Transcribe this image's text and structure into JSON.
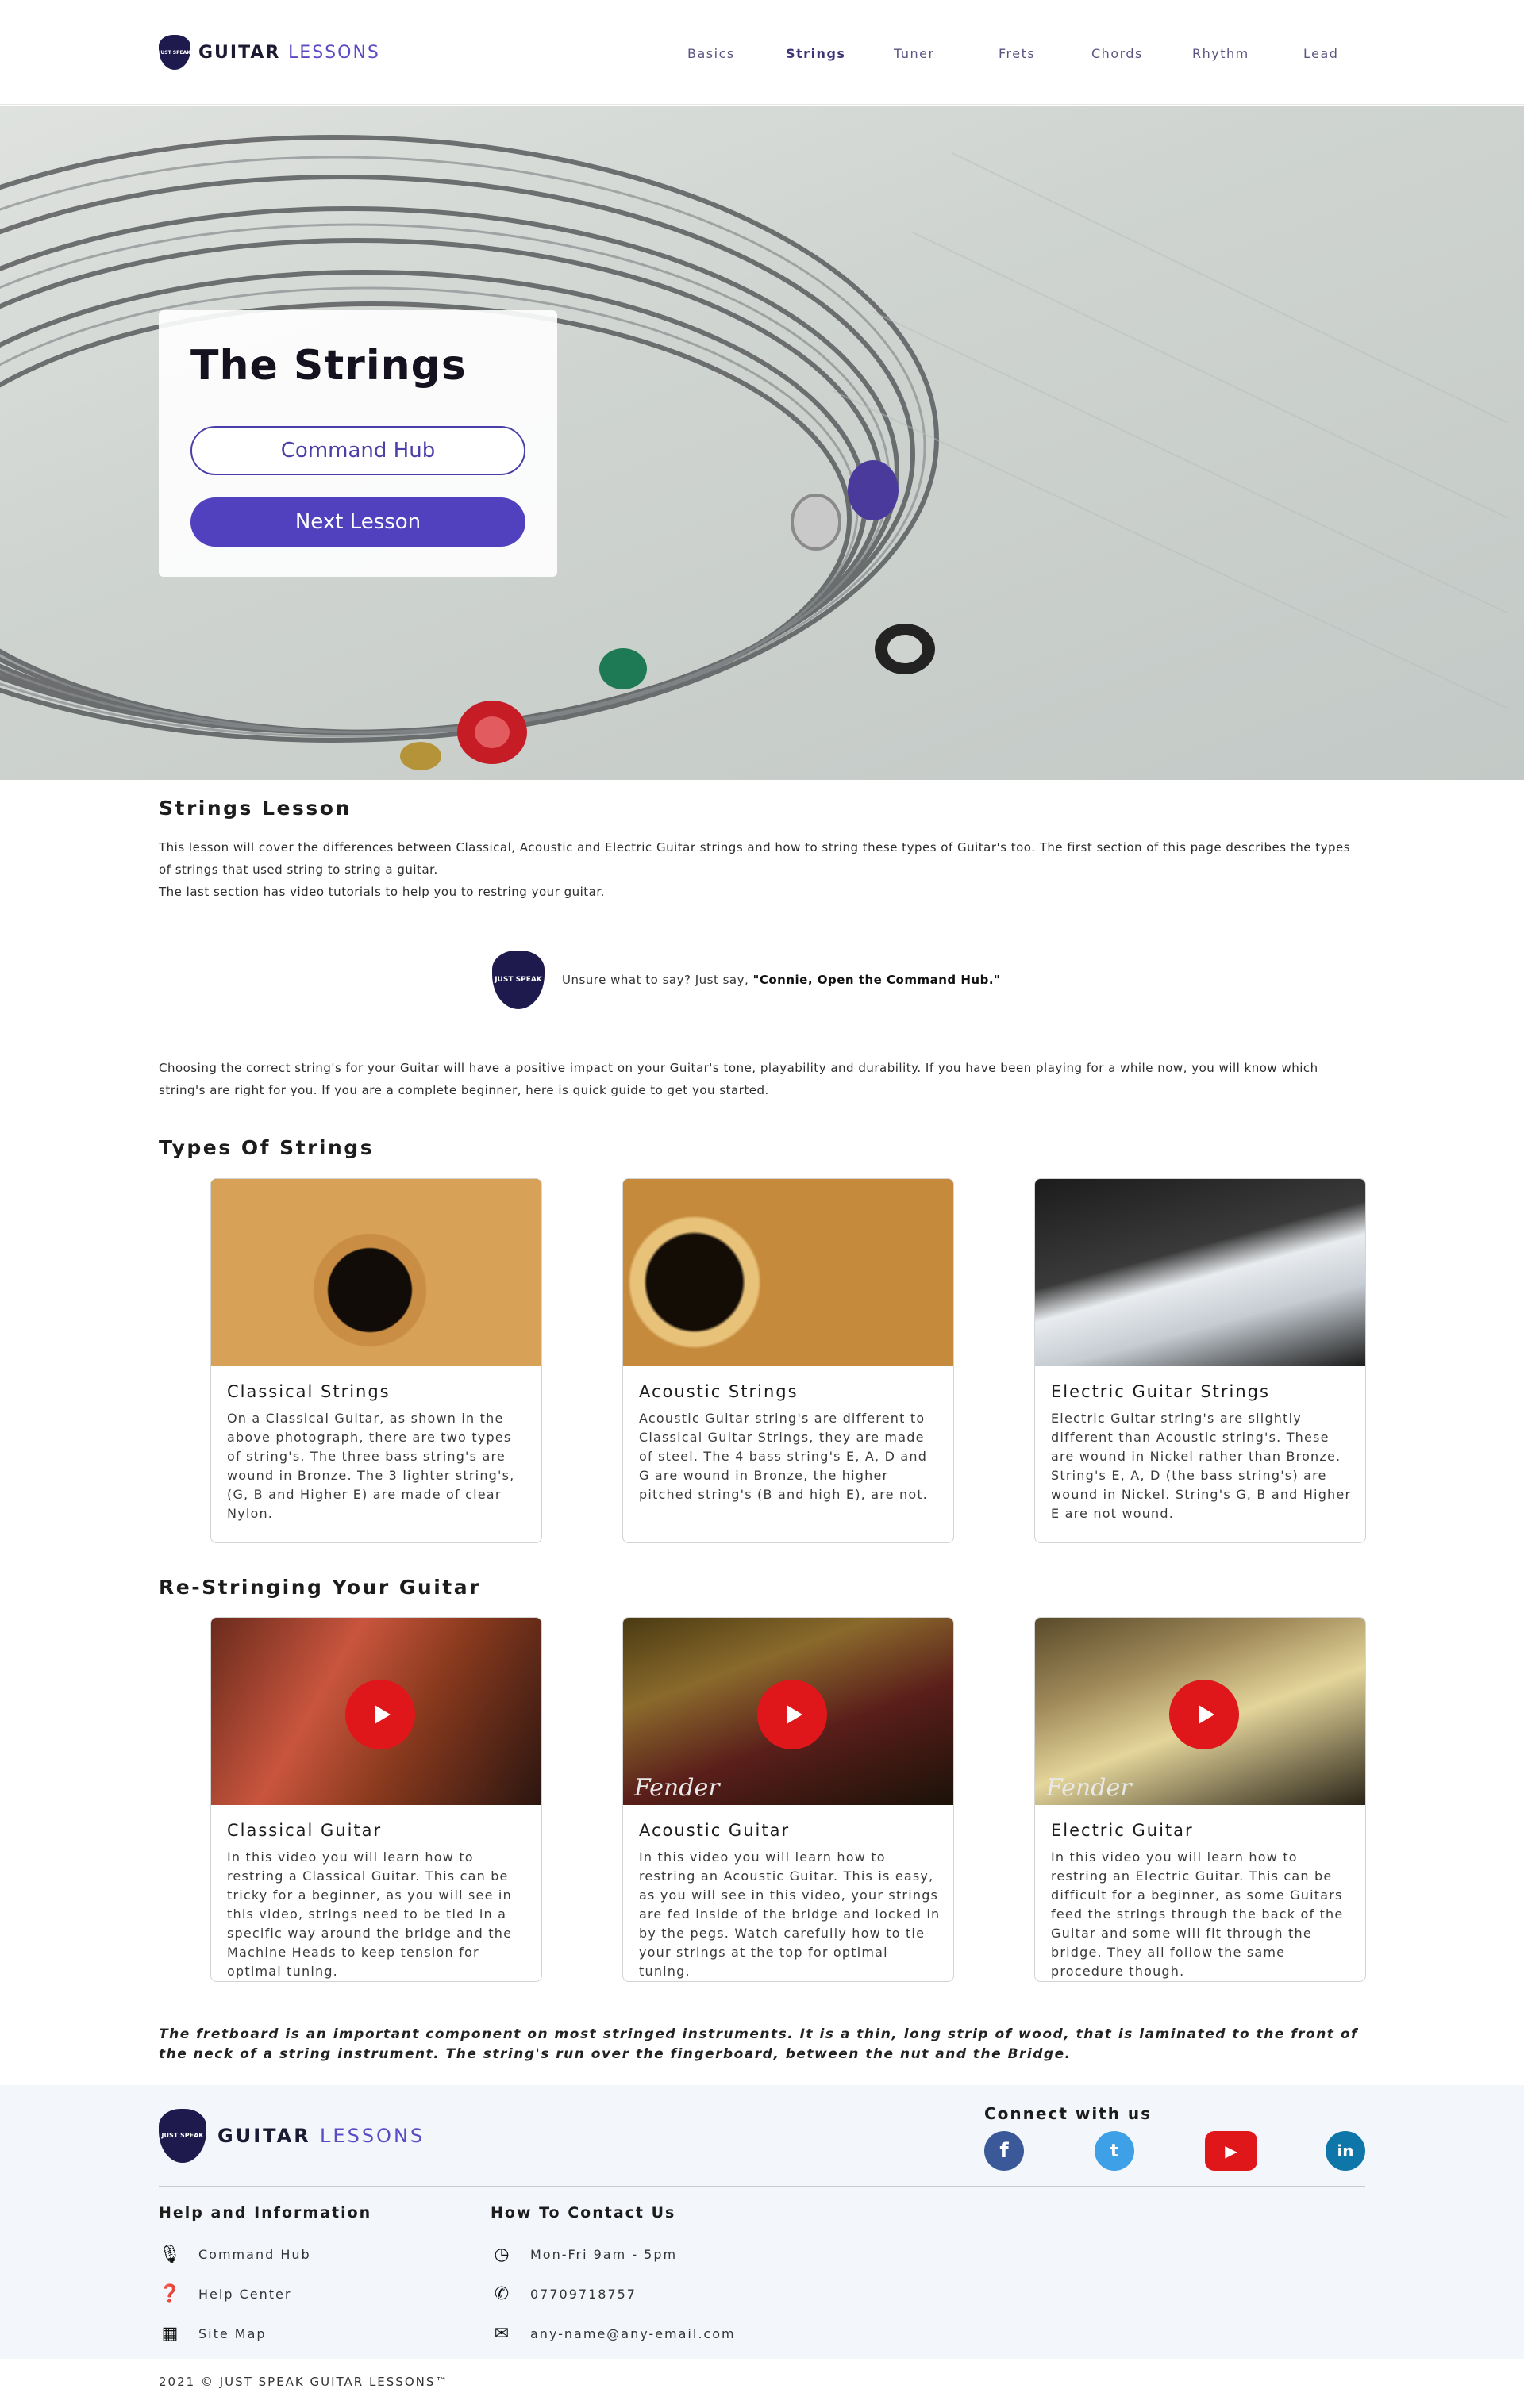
{
  "header": {
    "logo_brand": "GUITAR",
    "logo_accent": "LESSONS",
    "logo_pick_text": "JUST SPEAK",
    "nav": [
      {
        "label": "Basics"
      },
      {
        "label": "Strings"
      },
      {
        "label": "Tuner"
      },
      {
        "label": "Frets"
      },
      {
        "label": "Chords"
      },
      {
        "label": "Rhythm"
      },
      {
        "label": "Lead"
      }
    ],
    "active_nav": "Strings"
  },
  "hero": {
    "title": "The Strings",
    "primary_button": "Command Hub",
    "secondary_button": "Next Lesson"
  },
  "lesson": {
    "heading": "Strings Lesson",
    "intro_1": "This lesson will cover the differences between Classical, Acoustic and Electric Guitar strings and how to string these types of Guitar's too. The first section of this page describes the types of strings that used string to string a guitar.",
    "intro_2": "The last section has video tutorials to help you to restring your guitar.",
    "assist_prefix": "Unsure what to say? Just say, ",
    "assist_phrase": "\"Connie, Open the Command Hub.\"",
    "choosing": "Choosing the correct string's for your Guitar will have a positive impact on your Guitar's tone, playability and durability. If you have been playing for a while now, you will know which string's are right for you. If you are a complete beginner, here is quick guide to get you started."
  },
  "types": {
    "heading": "Types Of Strings",
    "cards": [
      {
        "title": "Classical Strings",
        "text": "On a Classical Guitar, as shown in the above photograph, there are two types of string's. The three bass string's are wound in Bronze. The 3 lighter string's, (G, B and Higher E) are made of clear Nylon."
      },
      {
        "title": "Acoustic Strings",
        "text": "Acoustic Guitar string's are different to Classical Guitar Strings, they are made of steel. The 4 bass string's E, A, D and G are wound in Bronze, the higher pitched string's (B and high E), are not."
      },
      {
        "title": "Electric Guitar Strings",
        "text": "Electric Guitar string's are slightly different than Acoustic string's. These are wound in Nickel rather than Bronze. String's E, A, D (the bass string's) are wound in Nickel. String's G, B and Higher E are not  wound."
      }
    ]
  },
  "restring": {
    "heading": "Re-Stringing Your Guitar",
    "cards": [
      {
        "title": "Classical Guitar",
        "text": "In this video you will learn how to restring a Classical Guitar. This can be tricky for a beginner, as you will see in this video, strings need to be tied in a specific way around the bridge and the Machine Heads to keep tension for optimal tuning."
      },
      {
        "title": "Acoustic Guitar",
        "text": "In this video you will learn how to restring an Acoustic Guitar. This is easy, as you will see in this video, your strings are fed inside of the bridge and locked in by the pegs. Watch carefully how to tie your strings at the top for optimal tuning."
      },
      {
        "title": "Electric Guitar",
        "text": "In this video you will learn how to restring an Electric Guitar. This can be difficult for a beginner, as some Guitars feed the strings through the back of the Guitar and some will fit through the bridge. They all follow the same procedure though."
      }
    ],
    "watermark": "Fender"
  },
  "quote": "The fretboard is an important component on most stringed instruments. It is a thin, long strip of wood, that is laminated to the front of the neck of a string instrument. The string's run over the fingerboard, between the nut and the Bridge.",
  "footer": {
    "connect": "Connect with us",
    "social": [
      {
        "icon": "facebook-icon",
        "glyph": "f",
        "color": "#3b5998"
      },
      {
        "icon": "twitter-icon",
        "glyph": "t",
        "color": "#3ea0e6"
      },
      {
        "icon": "youtube-icon",
        "glyph": "▶",
        "color": "#e0171a"
      },
      {
        "icon": "linkedin-icon",
        "glyph": "in",
        "color": "#0e76a8"
      }
    ],
    "help_heading": "Help and Information",
    "help_items": [
      {
        "icon": "microphone-icon",
        "label": "Command Hub"
      },
      {
        "icon": "question-icon",
        "label": "Help Center"
      },
      {
        "icon": "map-icon",
        "label": "Site Map"
      }
    ],
    "contact_heading": "How To Contact Us",
    "contact_items": [
      {
        "icon": "clock-icon",
        "label": "Mon-Fri 9am - 5pm"
      },
      {
        "icon": "phone-icon",
        "label": "07709718757"
      },
      {
        "icon": "mail-icon",
        "label": "any-name@any-email.com"
      }
    ],
    "copyright": "2021 © JUST SPEAK GUITAR LESSONS™"
  }
}
